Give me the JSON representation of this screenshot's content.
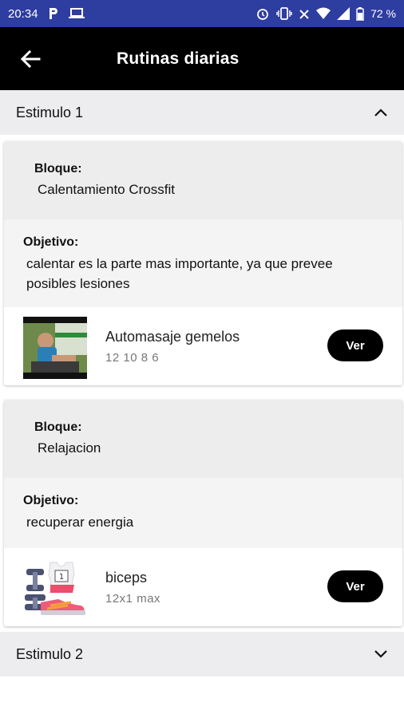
{
  "status_bar": {
    "time": "20:34",
    "battery": "72 %",
    "bg_color": "#2E3DA0",
    "icons_left": [
      "p-icon",
      "laptop-icon"
    ],
    "icons_right": [
      "alarm-icon",
      "vibrate-icon",
      "signal-icon",
      "wifi-icon",
      "cell-signal-icon",
      "battery-icon"
    ]
  },
  "app_bar": {
    "title": "Rutinas diarias",
    "back_icon": "arrow-left-icon"
  },
  "stimuli": [
    {
      "title": "Estimulo 1",
      "expanded": true,
      "blocks": [
        {
          "bloque_label": "Bloque:",
          "bloque_value": "Calentamiento Crossfit",
          "objetivo_label": "Objetivo:",
          "objetivo_value": "calentar es la parte mas importante, ya que prevee posibles lesiones",
          "exercise": {
            "name": "Automasaje gemelos",
            "detail": "12 10 8 6",
            "button": "Ver",
            "thumb": "video-thumbnail"
          }
        },
        {
          "bloque_label": "Bloque:",
          "bloque_value": "Relajacion",
          "objetivo_label": "Objetivo:",
          "objetivo_value": "recuperar energia",
          "exercise": {
            "name": "biceps",
            "detail": "12x1 max",
            "button": "Ver",
            "thumb": "gym-icon"
          }
        }
      ]
    },
    {
      "title": "Estimulo 2",
      "expanded": false
    }
  ]
}
